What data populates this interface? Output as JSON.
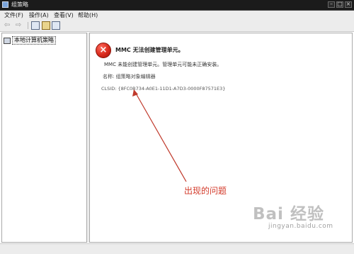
{
  "window": {
    "title": "组策略"
  },
  "menubar": {
    "items": [
      "文件(F)",
      "操作(A)",
      "查看(V)",
      "帮助(H)"
    ]
  },
  "toolbar": {
    "back": "⇦",
    "forward": "⇨"
  },
  "tree": {
    "root_label": "本地计算机策略"
  },
  "error": {
    "title": "MMC 无法创建管理单元。",
    "description": "MMC 未能创建管理单元。管理单元可能未正确安装。",
    "name_line": "名称: 组策略对象编辑器",
    "clsid_line": "CLSID: {8FC0B734-A0E1-11D1-A7D3-0000F87571E3}"
  },
  "annotation": {
    "text": "出现的问题",
    "color": "#d33a2a"
  },
  "watermark": {
    "main": "Bai 经验",
    "sub": "jingyan.baidu.com"
  }
}
